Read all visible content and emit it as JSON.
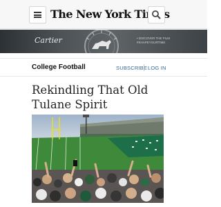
{
  "header": {
    "logo_text": "The New York Times",
    "menu_icon": "hamburger-menu-icon",
    "search_icon": "search-icon"
  },
  "ad": {
    "brand": "Cartier",
    "text": "• Discover the film #SHAPEYOURTIME"
  },
  "section": {
    "title": "College Football",
    "subscribe_label": "SUBSCRIBE",
    "login_label": "LOG IN"
  },
  "article": {
    "headline": "Rekindling That Old Tulane Spirit"
  },
  "colors": {
    "link": "#326891",
    "topbar_bg": "#f7f7f7",
    "field_green": "#3f8a3a"
  }
}
